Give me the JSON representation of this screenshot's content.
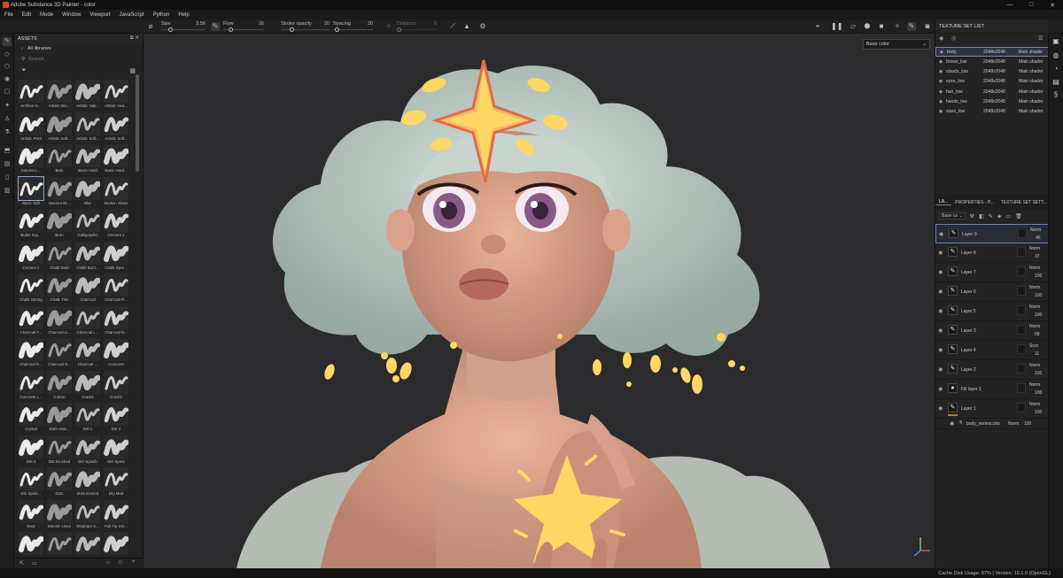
{
  "window": {
    "title": "Adobe Substance 3D Painter - color",
    "controls": [
      "—",
      "□",
      "✕"
    ]
  },
  "menu": [
    "File",
    "Edit",
    "Mode",
    "Window",
    "Viewport",
    "JavaScript",
    "Python",
    "Help"
  ],
  "toolbar": {
    "params": [
      {
        "label": "Size",
        "value": "3.56"
      },
      {
        "label": "Flow",
        "value": "16"
      },
      {
        "label": "Stroke opacity",
        "value": "20"
      },
      {
        "label": "Spacing",
        "value": "20"
      },
      {
        "label": "Distance",
        "value": "0"
      }
    ]
  },
  "assets": {
    "title": "ASSETS",
    "library": "All libraries",
    "search_placeholder": "Search",
    "items": [
      "Archive In...",
      "Artistic Bru...",
      "Artistic Hair...",
      "Artistic Hea...",
      "Artistic Print",
      "Artistic Soft...",
      "Artistic Soft...",
      "Artistic Soft...",
      "Autumn L...",
      "Bark",
      "Basic Hard",
      "Basic Hard...",
      "Basic Soft",
      "Basmet Br...",
      "Blur",
      "Broken Glass",
      "Bullet Imp...",
      "Burn",
      "Calligraphic",
      "Cement 1",
      "Cement 2",
      "Chalk Bold",
      "Chalk Burn...",
      "Chalk Spre...",
      "Chalk Strong",
      "Chalk Thin",
      "Charcoal",
      "Charcoal Fi...",
      "Charcoal F...",
      "Charcoal Li...",
      "Charcoal L...",
      "Charcoal N...",
      "Charcoal R...",
      "Charcoal S...",
      "Charcoal ...",
      "Concrete",
      "Concrete L...",
      "Cotton",
      "Cracks",
      "Cracks",
      "Crystal",
      "Dark Hatc...",
      "Dirt 1",
      "Dirt 2",
      "Dirt 3",
      "Dirt Brushed",
      "Dirt Splash",
      "Dirt Spots",
      "Dirt Spots...",
      "Dots",
      "Dots Erased",
      "Dry Mud",
      "Dust",
      "Electric Lines",
      "Elephant S...",
      "Felt Tip Sm...",
      "",
      "",
      "",
      ""
    ]
  },
  "viewport": {
    "channel": "Base color"
  },
  "texture_set_list": {
    "title": "TEXTURE SET LIST",
    "rows": [
      {
        "name": "body",
        "res": "2048x2048",
        "shader": "Main shader"
      },
      {
        "name": "brows_low",
        "res": "2048x2048",
        "shader": "Main shader"
      },
      {
        "name": "clouds_low",
        "res": "2048x2048",
        "shader": "Main shader"
      },
      {
        "name": "eyes_low",
        "res": "2048x2048",
        "shader": "Main shader"
      },
      {
        "name": "hair_low",
        "res": "2048x2048",
        "shader": "Main shader"
      },
      {
        "name": "hands_low",
        "res": "2048x2048",
        "shader": "Main shader"
      },
      {
        "name": "stars_low",
        "res": "2048x2048",
        "shader": "Main shader"
      }
    ]
  },
  "layers_panel": {
    "tabs": [
      "LA...",
      "PROPERTIES - P...",
      "TEXTURE SET SETT..."
    ],
    "channel": "Base co",
    "layers": [
      {
        "name": "Layer 9",
        "blend": "Norm",
        "opacity": "46"
      },
      {
        "name": "Layer 8",
        "blend": "Norm",
        "opacity": "37"
      },
      {
        "name": "Layer 7",
        "blend": "Norm",
        "opacity": "100"
      },
      {
        "name": "Layer 6",
        "blend": "Norm",
        "opacity": "100"
      },
      {
        "name": "Layer 5",
        "blend": "Norm",
        "opacity": "100"
      },
      {
        "name": "Layer 3",
        "blend": "Norm",
        "opacity": "68"
      },
      {
        "name": "Layer 4",
        "blend": "Scrn",
        "opacity": "11"
      },
      {
        "name": "Layer 2",
        "blend": "Norm",
        "opacity": "100"
      },
      {
        "name": "Fill layer 1",
        "blend": "Norm",
        "opacity": "100"
      },
      {
        "name": "Layer 1",
        "blend": "Norm",
        "opacity": "100"
      }
    ],
    "sublayer": {
      "name": "body_vertexcolor",
      "blend": "Norm",
      "opacity": "100"
    }
  },
  "status": {
    "text": "Cache Disk Usage:  87% | Version: 10.1.0 (OpenGL)"
  },
  "colors": {
    "accent": "#6f87b4",
    "viewport_bg": "#2b2b2d",
    "star_yellow": "#ffd764"
  }
}
